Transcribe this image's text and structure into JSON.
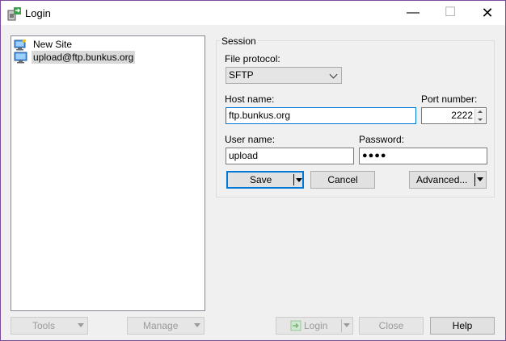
{
  "window": {
    "title": "Login"
  },
  "title_controls": {
    "minimize": "—",
    "maximize": "☐",
    "close": "✕"
  },
  "sites": [
    {
      "label": "New Site",
      "icon": "new-site-icon"
    },
    {
      "label": "upload@ftp.bunkus.org",
      "icon": "computer-icon",
      "selected": true
    }
  ],
  "session": {
    "group_label": "Session",
    "file_protocol_label": "File protocol:",
    "file_protocol_value": "SFTP",
    "host_label": "Host name:",
    "host_value": "ftp.bunkus.org",
    "port_label": "Port number:",
    "port_value": "2222",
    "user_label": "User name:",
    "user_value": "upload",
    "password_label": "Password:",
    "password_value": "●●●●",
    "save_label": "Save",
    "cancel_label": "Cancel",
    "advanced_label": "Advanced..."
  },
  "bottom": {
    "tools_label": "Tools",
    "manage_label": "Manage",
    "login_label": "Login",
    "close_label": "Close",
    "help_label": "Help"
  }
}
